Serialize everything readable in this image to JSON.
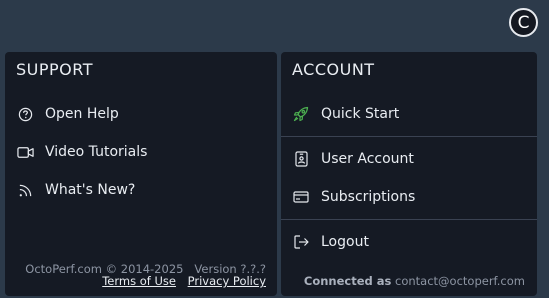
{
  "user": {
    "avatar_initial": "C"
  },
  "support": {
    "title": "SUPPORT",
    "items": [
      {
        "label": "Open Help",
        "icon": "help-circle-icon"
      },
      {
        "label": "Video Tutorials",
        "icon": "video-camera-icon"
      },
      {
        "label": "What's New?",
        "icon": "rss-icon"
      }
    ],
    "copyright": "OctoPerf.com © 2014-2025",
    "version": "Version ?.?.?",
    "terms_label": "Terms of Use",
    "privacy_label": "Privacy Policy"
  },
  "account": {
    "title": "ACCOUNT",
    "items": [
      {
        "label": "Quick Start",
        "icon": "rocket-icon",
        "icon_color": "#4caf50"
      },
      {
        "label": "User Account",
        "icon": "id-badge-icon"
      },
      {
        "label": "Subscriptions",
        "icon": "credit-card-icon"
      },
      {
        "label": "Logout",
        "icon": "logout-icon"
      }
    ],
    "connected_as_label": "Connected as",
    "email": "contact@octoperf.com"
  },
  "colors": {
    "background": "#2c3a4a",
    "panel": "#151a24",
    "accent_green": "#4caf50"
  }
}
